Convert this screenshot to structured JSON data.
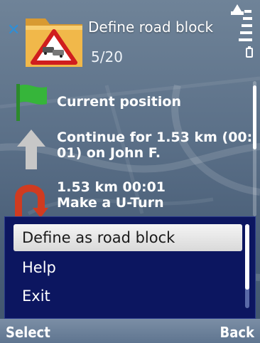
{
  "header": {
    "title": "Define road block",
    "counter": "5/20",
    "close_icon": "close-x-icon"
  },
  "route": {
    "items": [
      {
        "icon": "green-flag-icon",
        "text": "Current position"
      },
      {
        "icon": "up-arrow-icon",
        "text_line1": "Continue for 1.53 km (00:",
        "text_line2": "01) on John F."
      },
      {
        "icon": "u-turn-icon",
        "text_line1": "1.53 km 00:01",
        "text_line2": "Make a U-Turn"
      }
    ]
  },
  "menu": {
    "items": [
      {
        "label": "Define as road block",
        "selected": true
      },
      {
        "label": "Help",
        "selected": false
      },
      {
        "label": "Exit",
        "selected": false
      }
    ]
  },
  "softkeys": {
    "left": "Select",
    "right": "Back"
  },
  "colors": {
    "menu_background": "#0c1660",
    "selection": "#e6e6e6",
    "accent_blue": "#2d8fd8",
    "flag_green": "#36b53a"
  }
}
